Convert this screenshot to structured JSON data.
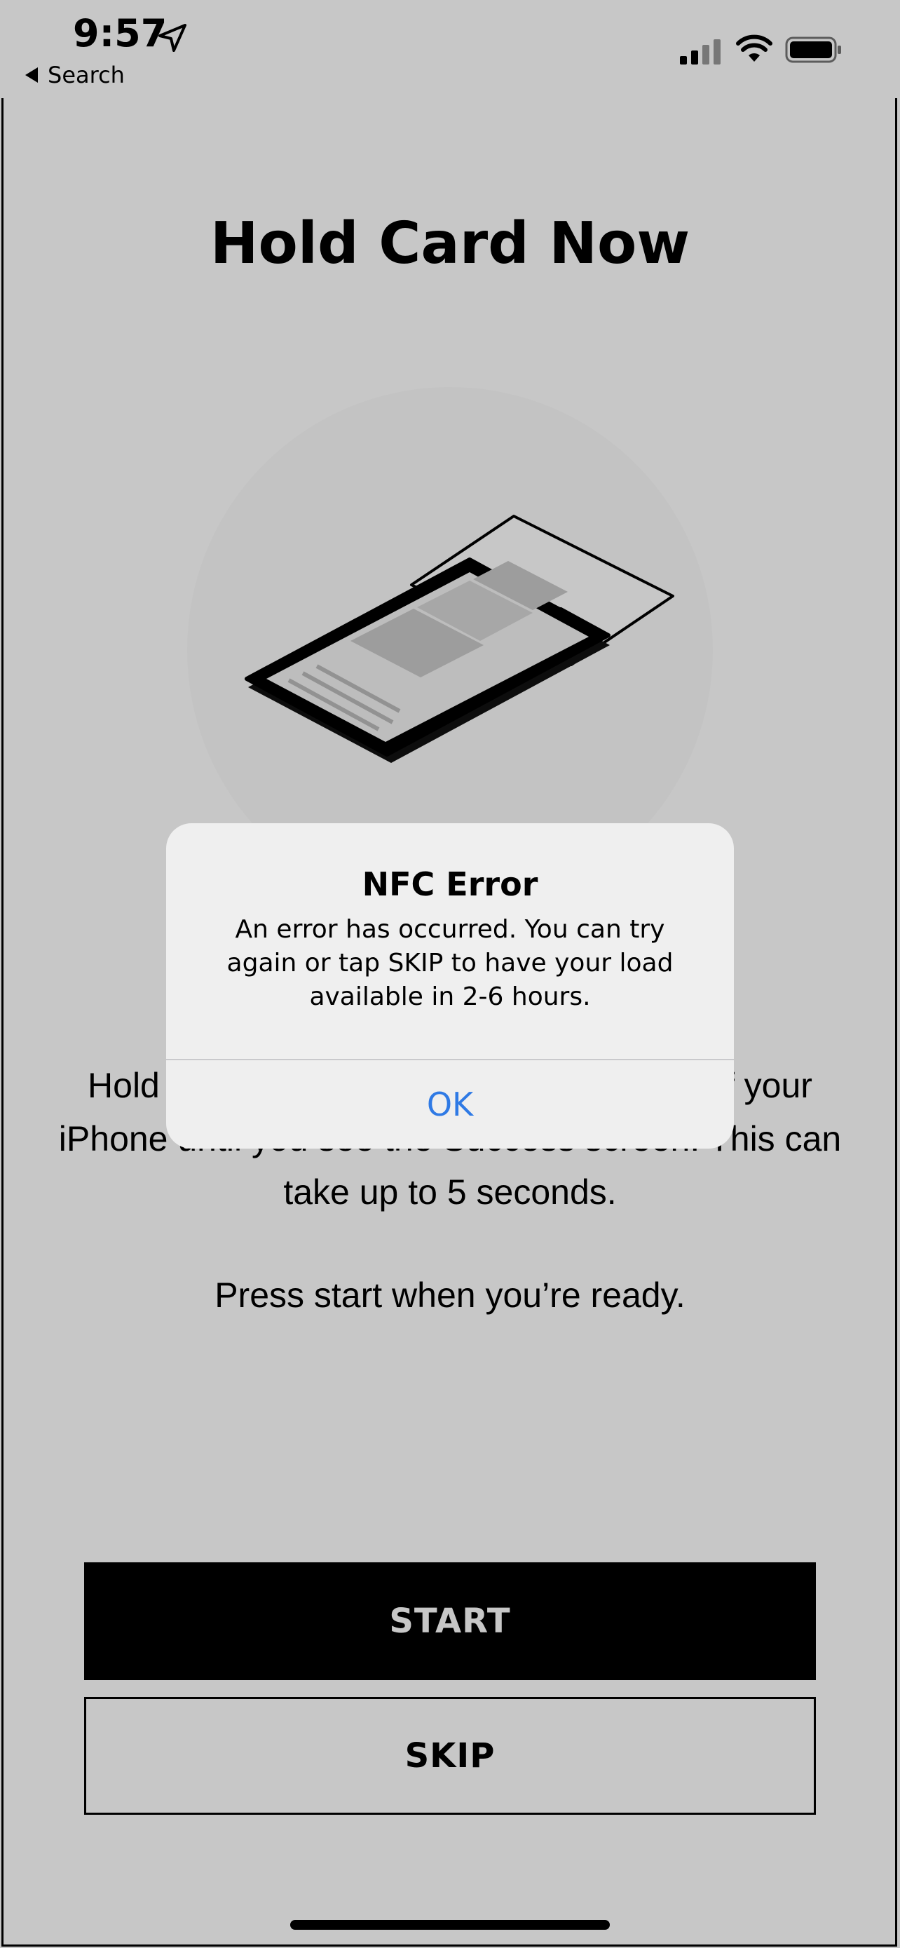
{
  "status_bar": {
    "time": "9:57",
    "back_label": "Search",
    "icons": [
      "location-arrow-icon",
      "signal-icon",
      "wifi-icon",
      "battery-icon"
    ]
  },
  "screen": {
    "title": "Hold Card Now",
    "illustration": "phone-over-card-illustration",
    "instructions": "Hold your card flat against the top back of your iPhone until you see the Success screen. This can take up to 5 seconds.",
    "ready_text": "Press start when you’re ready.",
    "start_label": "START",
    "skip_label": "SKIP"
  },
  "alert": {
    "title": "NFC Error",
    "message": "An error has occurred. You can try again or tap SKIP to have your load available in 2-6 hours.",
    "ok_label": "OK"
  },
  "colors": {
    "dim_overlay": "#c6c6c6",
    "alert_bg": "#efefef",
    "ok_blue": "#2f7ae5",
    "primary_button": "#000000"
  }
}
